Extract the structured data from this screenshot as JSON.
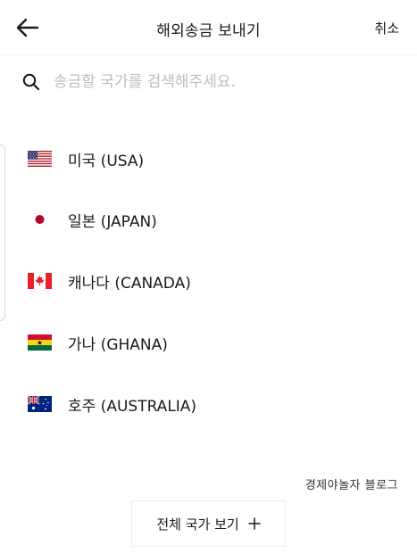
{
  "header": {
    "title": "해외송금 보내기",
    "cancel_label": "취소",
    "back_icon": "arrow-left-icon"
  },
  "search": {
    "placeholder": "송금할 국가를 검색해주세요.",
    "value": "",
    "icon": "search-icon"
  },
  "countries": [
    {
      "label": "미국 (USA)",
      "flag": "flag-usa-icon"
    },
    {
      "label": "일본 (JAPAN)",
      "flag": "flag-japan-icon"
    },
    {
      "label": "캐나다 (CANADA)",
      "flag": "flag-canada-icon"
    },
    {
      "label": "가나 (GHANA)",
      "flag": "flag-ghana-icon"
    },
    {
      "label": "호주 (AUSTRALIA)",
      "flag": "flag-australia-icon"
    }
  ],
  "footer": {
    "blog_credit": "경제야놀자 블로그",
    "view_all_label": "전체 국가 보기",
    "view_all_icon": "plus-icon"
  },
  "colors": {
    "text": "#1a1a1a",
    "placeholder": "#bdbdbd",
    "divider": "#f2f2f2"
  }
}
